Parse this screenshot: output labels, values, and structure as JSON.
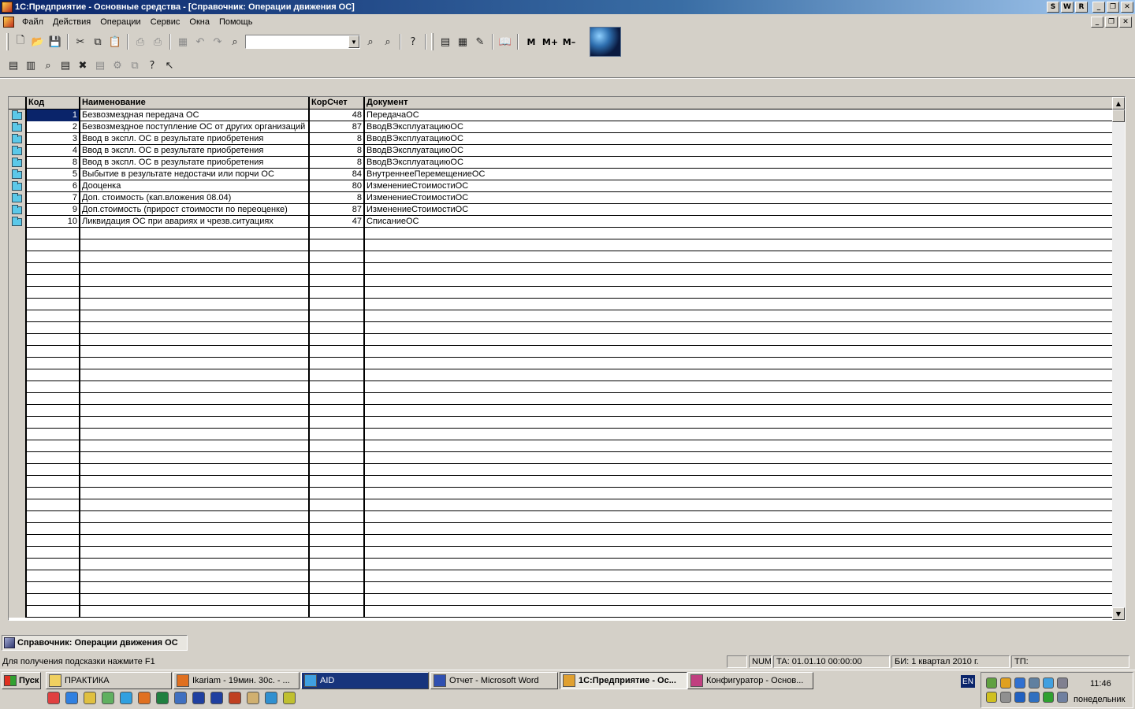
{
  "window": {
    "title": "1С:Предприятие - Основные средства - [Справочник: Операции движения ОС]",
    "controls": [
      "S",
      "W",
      "R"
    ]
  },
  "menu": [
    "Файл",
    "Действия",
    "Операции",
    "Сервис",
    "Окна",
    "Помощь"
  ],
  "toolbar": {
    "search_value": "",
    "m_label": "M",
    "m_plus_label": "M+",
    "m_minus_label": "M–"
  },
  "table": {
    "columns": [
      "Код",
      "Наименование",
      "КорСчет",
      "Документ"
    ],
    "rows": [
      {
        "code": "1",
        "name": "Безвозмездная передача ОС",
        "account": "48",
        "document": "ПередачаОС"
      },
      {
        "code": "2",
        "name": "Безвозмездное поступление ОС от других организаций",
        "account": "87",
        "document": "ВводВЭксплуатациюОС"
      },
      {
        "code": "3",
        "name": "Ввод в экспл. ОС в результате приобретения",
        "account": "8",
        "document": "ВводВЭксплуатациюОС"
      },
      {
        "code": "4",
        "name": "Ввод в экспл. ОС в результате приобретения",
        "account": "8",
        "document": "ВводВЭксплуатациюОС"
      },
      {
        "code": "8",
        "name": "Ввод в экспл. ОС в результате приобретения",
        "account": "8",
        "document": "ВводВЭксплуатациюОС"
      },
      {
        "code": "5",
        "name": "Выбытие в результате недостачи или порчи ОС",
        "account": "84",
        "document": "ВнутреннееПеремещениеОС"
      },
      {
        "code": "6",
        "name": "Дооценка",
        "account": "80",
        "document": "ИзменениеСтоимостиОС"
      },
      {
        "code": "7",
        "name": "Доп. стоимость (кап.вложения 08.04)",
        "account": "8",
        "document": "ИзменениеСтоимостиОС"
      },
      {
        "code": "9",
        "name": "Доп.стоимость (прирост стоимости по переоценке)",
        "account": "87",
        "document": "ИзменениеСтоимостиОС"
      },
      {
        "code": "10",
        "name": "Ликвидация ОС при авариях и чрезв.ситуациях",
        "account": "47",
        "document": "СписаниеОС"
      }
    ]
  },
  "window_tab": "Справочник: Операции движения ОС",
  "status": {
    "hint": "Для получения подсказки нажмите F1",
    "num": "NUM",
    "ta": "ТА: 01.01.10  00:00:00",
    "bi": "БИ: 1 квартал 2010 г.",
    "tp": "ТП:"
  },
  "taskbar": {
    "start": "Пуск",
    "tasks": [
      {
        "label": "ПРАКТИКА",
        "icon": "folder-icon",
        "color": "#f0d060"
      },
      {
        "label": "Ikariam - 19мин. 30с. - ...",
        "icon": "firefox-icon",
        "color": "#e07020"
      },
      {
        "label": "AID",
        "icon": "chat-icon",
        "color": "#40a0e0"
      },
      {
        "label": "Отчет - Microsoft Word",
        "icon": "word-icon",
        "color": "#3050b0"
      },
      {
        "label": "1С:Предприятие - Ос...",
        "icon": "1c-icon",
        "color": "#e0a030"
      },
      {
        "label": "Конфигуратор - Основ...",
        "icon": "1c-config-icon",
        "color": "#c04080"
      }
    ],
    "lang": "EN",
    "clock": "11:46",
    "day": "понедельник"
  }
}
